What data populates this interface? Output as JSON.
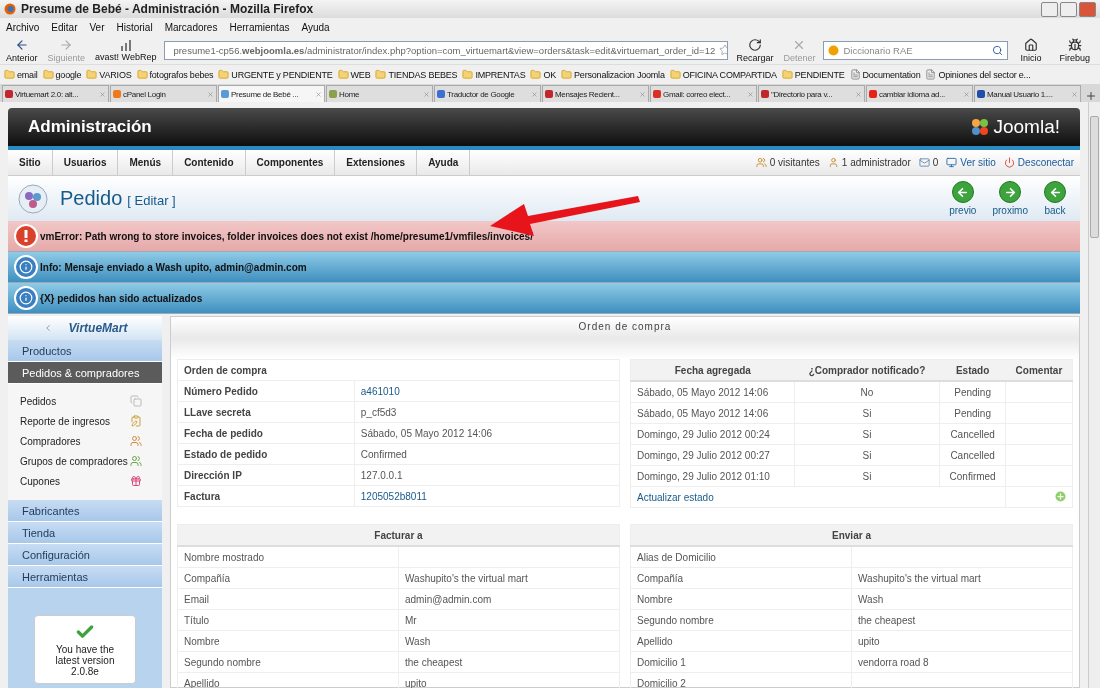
{
  "browser": {
    "title": "Presume de Bebé - Administración - Mozilla Firefox",
    "menu": [
      "Archivo",
      "Editar",
      "Ver",
      "Historial",
      "Marcadores",
      "Herramientas",
      "Ayuda"
    ],
    "nav_left": [
      {
        "label": "Anterior",
        "kind": "back",
        "disabled": false
      },
      {
        "label": "Siguiente",
        "kind": "forward",
        "disabled": true
      },
      {
        "label": "avast! WebRep",
        "kind": "avast",
        "disabled": false
      }
    ],
    "url": "presume1-cp56.**webjoomla.es**/administrator/index.php?option=com_virtuemart&view=orders&task=edit&virtuemart_order_id=12",
    "nav_right": [
      {
        "label": "Recargar",
        "kind": "reload",
        "disabled": false
      },
      {
        "label": "Detener",
        "kind": "stop",
        "disabled": true
      }
    ],
    "search": {
      "placeholder": "Diccionario RAE"
    },
    "tools": [
      {
        "label": "Inicio",
        "kind": "home"
      },
      {
        "label": "Firebug",
        "kind": "bug"
      }
    ],
    "bookmarks": [
      {
        "label": "email",
        "kind": "folder"
      },
      {
        "label": "google",
        "kind": "folder"
      },
      {
        "label": "VARIOS",
        "kind": "folder"
      },
      {
        "label": "fotografos bebes",
        "kind": "folder"
      },
      {
        "label": "URGENTE y PENDIENTE",
        "kind": "folder"
      },
      {
        "label": "WEB",
        "kind": "folder"
      },
      {
        "label": "TIENDAS BEBES",
        "kind": "folder"
      },
      {
        "label": "IMPRENTAS",
        "kind": "folder"
      },
      {
        "label": "OK",
        "kind": "folder"
      },
      {
        "label": "Personalizacion Joomla",
        "kind": "folder"
      },
      {
        "label": "OFICINA COMPARTIDA",
        "kind": "folder"
      },
      {
        "label": "PENDIENTE",
        "kind": "folder"
      },
      {
        "label": "Documentation",
        "kind": "page"
      },
      {
        "label": "Opiniones del sector e...",
        "kind": "page"
      }
    ],
    "tabs": [
      {
        "label": "Virtuemart 2.0: alt...",
        "selected": false,
        "color": "#c0282d"
      },
      {
        "label": "cPanel Login",
        "selected": false,
        "color": "#f07a1a"
      },
      {
        "label": "Presume de Bebé ...",
        "selected": true,
        "color": "#5b9bd5"
      },
      {
        "label": "Home",
        "selected": false,
        "color": "#8aa04a"
      },
      {
        "label": "Traductor de Google",
        "selected": false,
        "color": "#3b6fd0"
      },
      {
        "label": "Mensajes Recient...",
        "selected": false,
        "color": "#c0282d"
      },
      {
        "label": "Gmail: correo elect...",
        "selected": false,
        "color": "#d93025"
      },
      {
        "label": "\"Directorio para v...",
        "selected": false,
        "color": "#c0282d"
      },
      {
        "label": "cambiar idioma ad...",
        "selected": false,
        "color": "#e62117"
      },
      {
        "label": "Manual Usuario 1....",
        "selected": false,
        "color": "#1f4fa8"
      }
    ]
  },
  "admin": {
    "title": "Administración",
    "logo": "Joomla!",
    "menu": [
      "Sitio",
      "Usuarios",
      "Menús",
      "Contenido",
      "Componentes",
      "Extensiones",
      "Ayuda"
    ],
    "status": [
      {
        "label": "0 visitantes",
        "kind": "visitors"
      },
      {
        "label": "1 administrador",
        "kind": "admin"
      },
      {
        "label": "0",
        "kind": "mail"
      },
      {
        "label": "Ver sitio",
        "kind": "site"
      },
      {
        "label": "Desconectar",
        "kind": "logout"
      }
    ],
    "page_title": "Pedido",
    "page_subtitle": "[ Editar ]",
    "actions": [
      {
        "label": "previo",
        "kind": "prev"
      },
      {
        "label": "proximo",
        "kind": "next"
      },
      {
        "label": "back",
        "kind": "back"
      }
    ]
  },
  "messages": [
    {
      "kind": "error",
      "text": "vmError: Path wrong to store invoices, folder invoices does not exist /home/presume1/vmfiles/invoices/"
    },
    {
      "kind": "info",
      "text": "Info: Mensaje enviado a Wash upito, admin@admin.com"
    },
    {
      "kind": "info",
      "text": "{X} pedidos han sido actualizados"
    }
  ],
  "sidebar": {
    "logo": "VirtueMart",
    "sections": [
      {
        "label": "Productos",
        "selected": false
      },
      {
        "label": "Pedidos & compradores",
        "selected": true,
        "children": [
          {
            "label": "Pedidos",
            "kind": "pages"
          },
          {
            "label": "Reporte de ingresos",
            "kind": "report"
          },
          {
            "label": "Compradores",
            "kind": "people"
          },
          {
            "label": "Grupos de compradores",
            "kind": "groups"
          },
          {
            "label": "Cupones",
            "kind": "gift"
          }
        ]
      },
      {
        "label": "Fabricantes",
        "selected": false
      },
      {
        "label": "Tienda",
        "selected": false
      },
      {
        "label": "Configuración",
        "selected": false
      },
      {
        "label": "Herramientas",
        "selected": false
      }
    ],
    "version": "You have the latest version 2.0.8e"
  },
  "content": {
    "panel_title": "Orden de compra",
    "order": {
      "title": "Orden de compra",
      "rows": [
        {
          "label": "Número Pedido",
          "value": "a461010",
          "kind": "link"
        },
        {
          "label": "LLave secreta",
          "value": "p_cf5d3",
          "kind": "text"
        },
        {
          "label": "Fecha de pedido",
          "value": "Sábado, 05 Mayo 2012 14:06",
          "kind": "text"
        },
        {
          "label": "Estado de pedido",
          "value": "Confirmed",
          "kind": "text"
        },
        {
          "label": "Dirección IP",
          "value": "127.0.0.1",
          "kind": "text"
        },
        {
          "label": "Factura",
          "value": "1205052b8011",
          "kind": "link"
        }
      ]
    },
    "history": {
      "columns": [
        "Fecha agregada",
        "¿Comprador notificado?",
        "Estado",
        "Comentar"
      ],
      "rows": [
        [
          "Sábado, 05 Mayo 2012 14:06",
          "No",
          "Pending"
        ],
        [
          "Sábado, 05 Mayo 2012 14:06",
          "Si",
          "Pending"
        ],
        [
          "Domingo, 29 Julio 2012 00:24",
          "Si",
          "Cancelled"
        ],
        [
          "Domingo, 29 Julio 2012 00:27",
          "Si",
          "Cancelled"
        ],
        [
          "Domingo, 29 Julio 2012 01:10",
          "Si",
          "Confirmed"
        ]
      ],
      "action": "Actualizar estado"
    },
    "bill_to": {
      "title": "Facturar a",
      "rows": [
        {
          "label": "Nombre mostrado"
        },
        {
          "label": "Compañía",
          "value": "Washupito's the virtual mart"
        },
        {
          "label": "Email",
          "value": "admin@admin.com"
        },
        {
          "label": "Título",
          "value": "Mr"
        },
        {
          "label": "Nombre",
          "value": "Wash"
        },
        {
          "label": "Segundo nombre",
          "value": "the cheapest"
        },
        {
          "label": "Apellido",
          "value": "upito"
        }
      ]
    },
    "ship_to": {
      "title": "Enviar a",
      "rows": [
        {
          "label": "Alias de Domicilio"
        },
        {
          "label": "Compañía",
          "value": "Washupito's the virtual mart"
        },
        {
          "label": "Nombre",
          "value": "Wash"
        },
        {
          "label": "Segundo nombre",
          "value": "the cheapest"
        },
        {
          "label": "Apellido",
          "value": "upito"
        },
        {
          "label": "Domicilio 1",
          "value": "vendorra road 8"
        },
        {
          "label": "Domicilio 2"
        }
      ]
    }
  }
}
